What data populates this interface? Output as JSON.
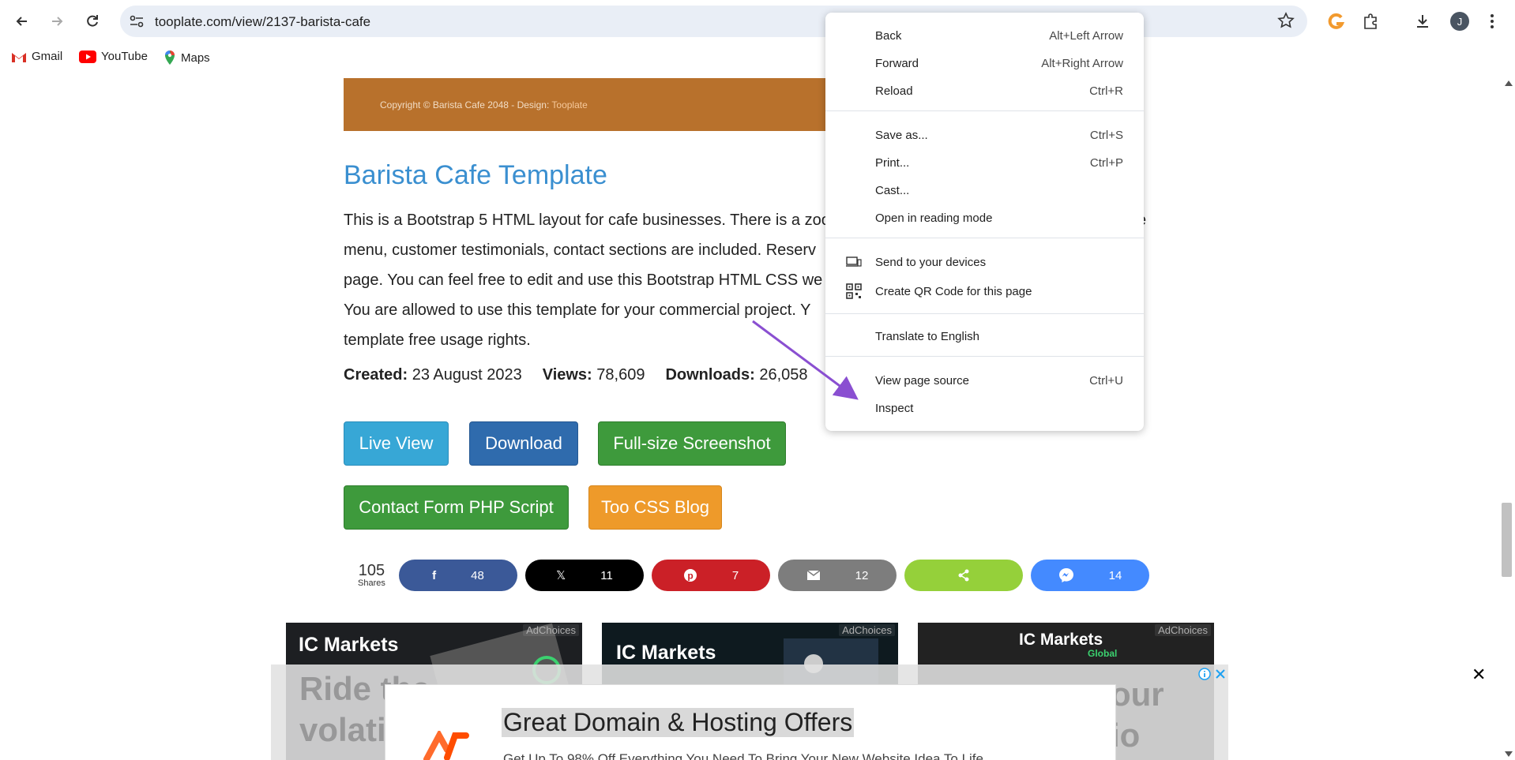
{
  "browser": {
    "url": "tooplate.com/view/2137-barista-cafe",
    "bookmarks": [
      "Gmail",
      "YouTube",
      "Maps"
    ],
    "profile_initial": "J"
  },
  "page": {
    "banner_copyright": "Copyright © Barista Cafe 2048 - Design:",
    "banner_link": "Tooplate",
    "title": "Barista Cafe Template",
    "desc_lines": [
      "This is a Bootstrap 5 HTML layout for cafe businesses. There is a zoo",
      "menu, customer testimonials, contact sections are included. Reserv",
      "page. You can feel free to edit and use this Bootstrap HTML CSS we",
      "You are allowed to use this template for your commercial project. Y",
      "template free usage rights."
    ],
    "desc_tail": "e",
    "meta": {
      "created_label": "Created:",
      "created_value": "23 August 2023",
      "views_label": "Views:",
      "views_value": "78,609",
      "downloads_label": "Downloads:",
      "downloads_value": "26,058"
    },
    "buttons": {
      "live": "Live View",
      "download": "Download",
      "full": "Full-size Screenshot",
      "contact": "Contact Form PHP Script",
      "blog": "Too CSS Blog"
    },
    "shares_total": "105",
    "shares_label": "Shares",
    "share_counts": {
      "facebook": "48",
      "x": "11",
      "pinterest": "7",
      "email": "12",
      "messenger": "14"
    },
    "ads": {
      "brand": "IC Markets",
      "brand_sub": "Global",
      "choices": "AdChoices",
      "overlay_left": "Ride the\nvolati\nwave",
      "overlay_right": "our\nio"
    },
    "sticky_ad": {
      "headline": "Great Domain & Hosting Offers",
      "sub": "Get Up To 98% Off Everything You Need To Bring Your New Website Idea To Life"
    }
  },
  "context_menu": {
    "items": [
      {
        "label": "Back",
        "shortcut": "Alt+Left Arrow"
      },
      {
        "label": "Forward",
        "shortcut": "Alt+Right Arrow"
      },
      {
        "label": "Reload",
        "shortcut": "Ctrl+R"
      },
      {
        "label": "Save as...",
        "shortcut": "Ctrl+S"
      },
      {
        "label": "Print...",
        "shortcut": "Ctrl+P"
      },
      {
        "label": "Cast...",
        "shortcut": ""
      },
      {
        "label": "Open in reading mode",
        "shortcut": ""
      },
      {
        "label": "Send to your devices",
        "shortcut": ""
      },
      {
        "label": "Create QR Code for this page",
        "shortcut": ""
      },
      {
        "label": "Translate to English",
        "shortcut": ""
      },
      {
        "label": "View page source",
        "shortcut": "Ctrl+U"
      },
      {
        "label": "Inspect",
        "shortcut": ""
      }
    ]
  },
  "colors": {
    "annotation_arrow": "#8a4fd1",
    "title_blue": "#3a8fd0",
    "facebook": "#3b5998",
    "x": "#000000",
    "pinterest": "#cb2027",
    "email": "#7d7d7d",
    "share": "#95d03a",
    "messenger": "#448aff"
  }
}
